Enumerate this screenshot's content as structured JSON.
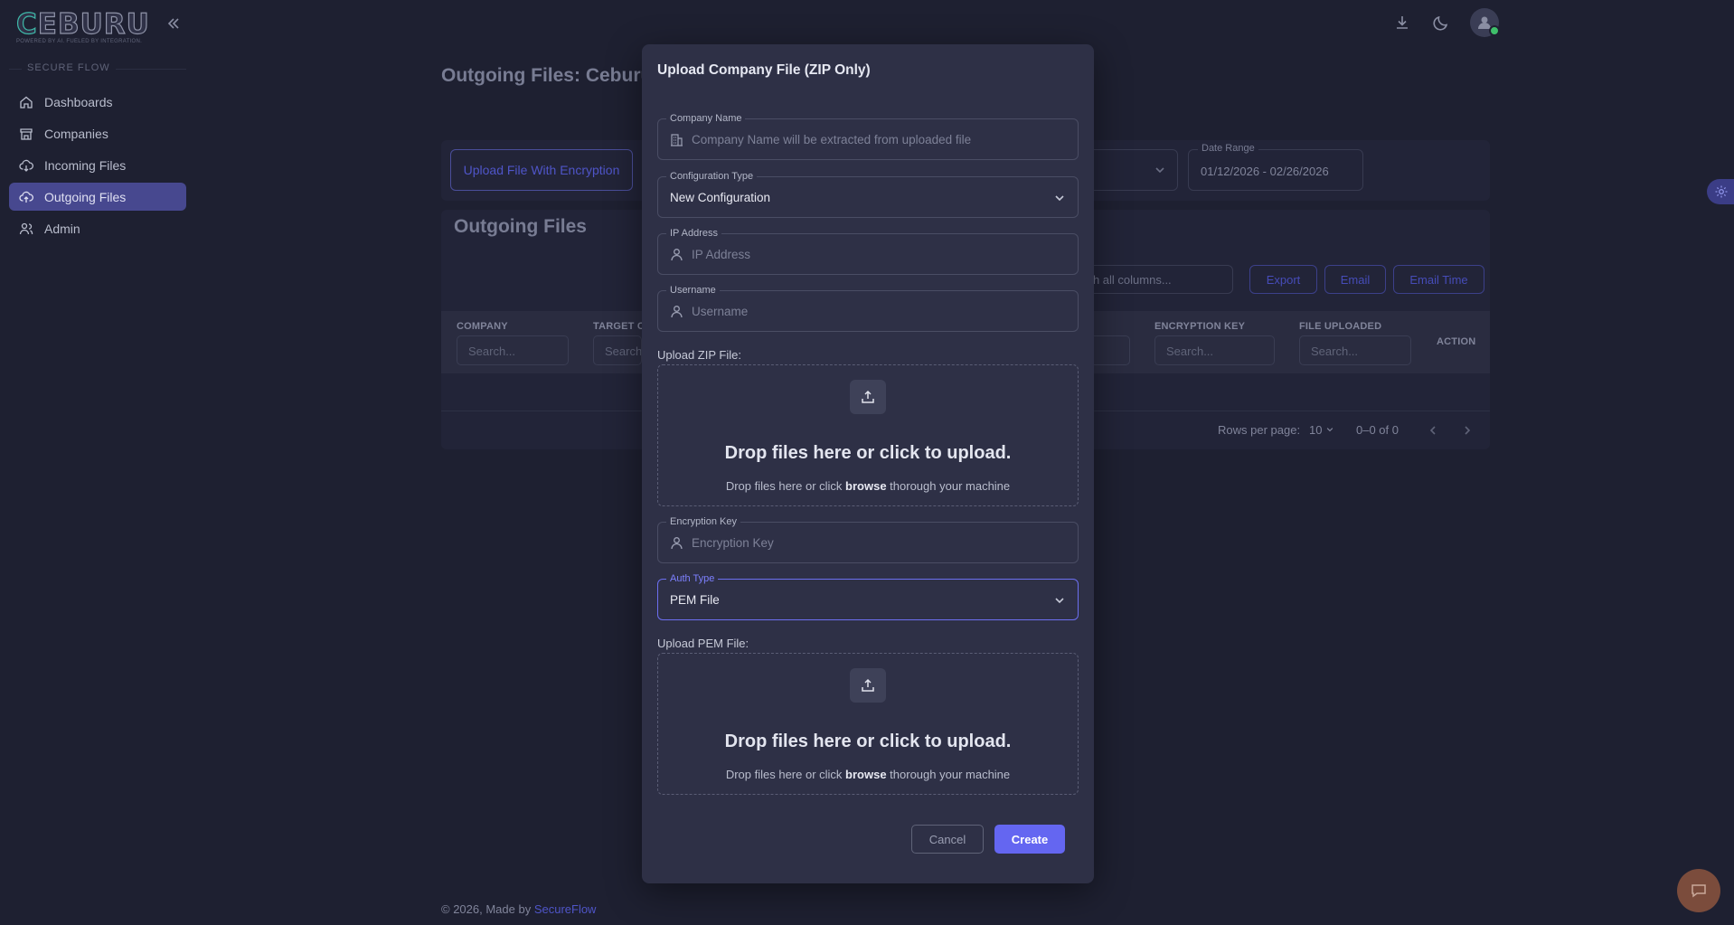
{
  "brand": {
    "logo_first": "C",
    "logo_rest": "EBURU",
    "tagline": "POWERED BY AI. FUELED BY INTEGRATION."
  },
  "sidebar": {
    "section_label": "SECURE FLOW",
    "items": [
      {
        "label": "Dashboards",
        "icon": "home-icon"
      },
      {
        "label": "Companies",
        "icon": "store-icon"
      },
      {
        "label": "Incoming Files",
        "icon": "cloud-download-icon"
      },
      {
        "label": "Outgoing Files",
        "icon": "cloud-upload-icon",
        "active": true
      },
      {
        "label": "Admin",
        "icon": "users-icon"
      }
    ]
  },
  "main": {
    "page_title": "Outgoing Files: Ceburu",
    "upload_button": "Upload File With Encryption",
    "date_range": {
      "label": "Date Range",
      "value": "01/12/2026 - 02/26/2026"
    },
    "table": {
      "title": "Outgoing Files",
      "search_placeholder": "Search all columns...",
      "buttons": {
        "export": "Export",
        "email": "Email",
        "email_time": "Email Time"
      },
      "columns": [
        {
          "header": "COMPANY",
          "placeholder": "Search..."
        },
        {
          "header": "TARGET C",
          "placeholder": "Search"
        },
        {
          "header": "ENCRYPTION KEY",
          "placeholder": "Search..."
        },
        {
          "header": "FILE UPLOADED",
          "placeholder": "Search..."
        },
        {
          "header": "ACTION"
        }
      ],
      "pager": {
        "rows_label": "Rows per page:",
        "rows_value": "10",
        "count": "0–0 of 0"
      }
    }
  },
  "footer": {
    "text": "© 2026, Made by ",
    "link": "SecureFlow"
  },
  "modal": {
    "title": "Upload Company File (ZIP Only)",
    "company_name": {
      "label": "Company Name",
      "placeholder": "Company Name will be extracted from uploaded file"
    },
    "config_type": {
      "label": "Configuration Type",
      "value": "New Configuration"
    },
    "ip_address": {
      "label": "IP Address",
      "placeholder": "IP Address"
    },
    "username": {
      "label": "Username",
      "placeholder": "Username"
    },
    "zip_upload": {
      "label": "Upload ZIP File:",
      "title": "Drop files here or click to upload.",
      "sub_pre": "Drop files here or click ",
      "sub_link": "browse",
      "sub_post": " thorough your machine"
    },
    "encryption_key": {
      "label": "Encryption Key",
      "placeholder": "Encryption Key"
    },
    "auth_type": {
      "label": "Auth Type",
      "value": "PEM File"
    },
    "pem_upload": {
      "label": "Upload PEM File:",
      "title": "Drop files here or click to upload.",
      "sub_pre": "Drop files here or click ",
      "sub_link": "browse",
      "sub_post": " thorough your machine"
    },
    "cancel": "Cancel",
    "create": "Create"
  },
  "colors": {
    "accent": "#6466f1",
    "active_nav": "#47488f",
    "background": "#1e2031",
    "modal": "#2e3046"
  }
}
